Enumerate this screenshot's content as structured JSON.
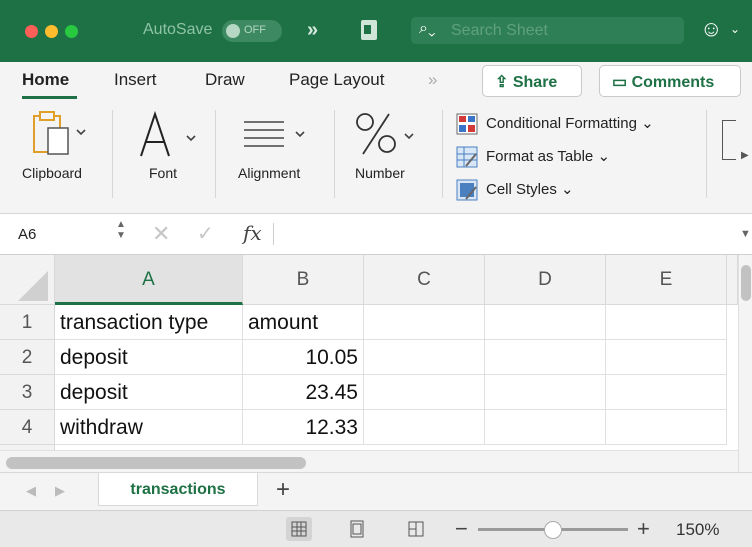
{
  "titlebar": {
    "autosave_label": "AutoSave",
    "autosave_state": "OFF",
    "more_chevron": "»",
    "search_placeholder": "Search Sheet"
  },
  "ribbon": {
    "tabs": [
      "Home",
      "Insert",
      "Draw",
      "Page Layout"
    ],
    "more": "»",
    "share_label": "Share",
    "comments_label": "Comments",
    "groups": {
      "clipboard": "Clipboard",
      "font": "Font",
      "alignment": "Alignment",
      "number": "Number"
    },
    "styles": [
      "Conditional Formatting",
      "Format as Table",
      "Cell Styles"
    ]
  },
  "formula_bar": {
    "name_box": "A6",
    "formula": ""
  },
  "sheet": {
    "columns": [
      "A",
      "B",
      "C",
      "D",
      "E"
    ],
    "selected_column": "A",
    "rows": [
      {
        "n": "1",
        "a": "transaction type",
        "b": "amount"
      },
      {
        "n": "2",
        "a": "deposit",
        "b": "10.05"
      },
      {
        "n": "3",
        "a": "deposit",
        "b": "23.45"
      },
      {
        "n": "4",
        "a": "withdraw",
        "b": "12.33"
      }
    ]
  },
  "sheet_tabs": {
    "active": "transactions",
    "add": "+"
  },
  "statusbar": {
    "zoom": "150%",
    "zoom_fraction": 0.5
  },
  "colors": {
    "brand": "#1e7145",
    "title_bar": "#1e7145"
  }
}
